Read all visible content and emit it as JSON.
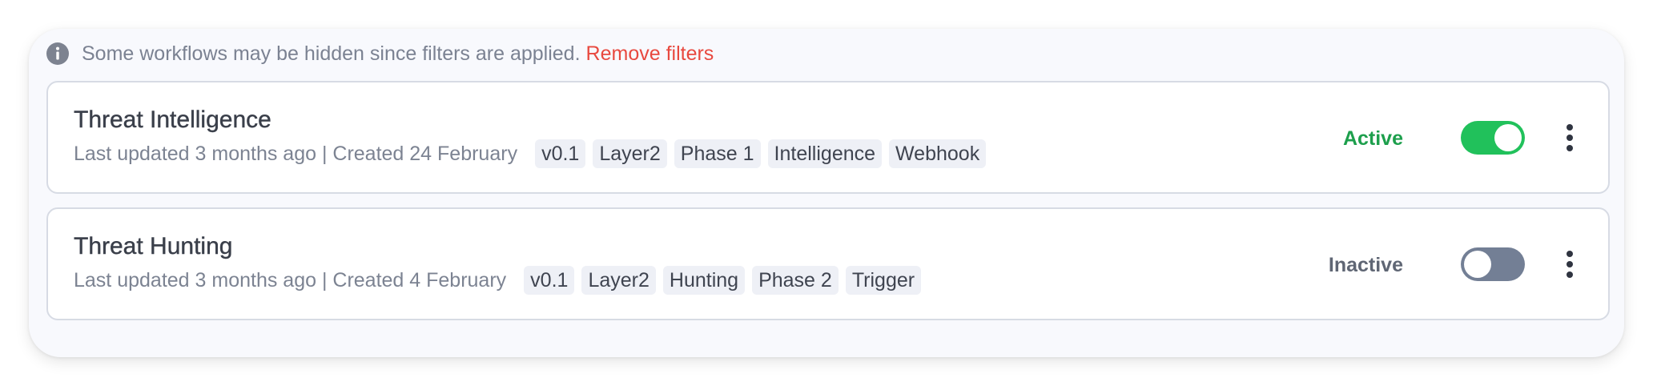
{
  "notice": {
    "text": "Some workflows may be hidden since filters are applied.",
    "link": "Remove filters",
    "icon": "info-icon"
  },
  "workflows": [
    {
      "title": "Threat Intelligence",
      "meta": "Last updated 3 months ago | Created 24 February",
      "tags": [
        "v0.1",
        "Layer2",
        "Phase 1",
        "Intelligence",
        "Webhook"
      ],
      "status": "Active",
      "enabled": true,
      "status_color": "#1d9f4c"
    },
    {
      "title": "Threat Hunting",
      "meta": "Last updated 3 months ago | Created 4 February",
      "tags": [
        "v0.1",
        "Layer2",
        "Hunting",
        "Phase 2",
        "Trigger"
      ],
      "status": "Inactive",
      "enabled": false,
      "status_color": "#5f6674"
    }
  ],
  "colors": {
    "toggle_on": "#21c15b",
    "toggle_off": "#737f95",
    "link": "#e8493f"
  }
}
